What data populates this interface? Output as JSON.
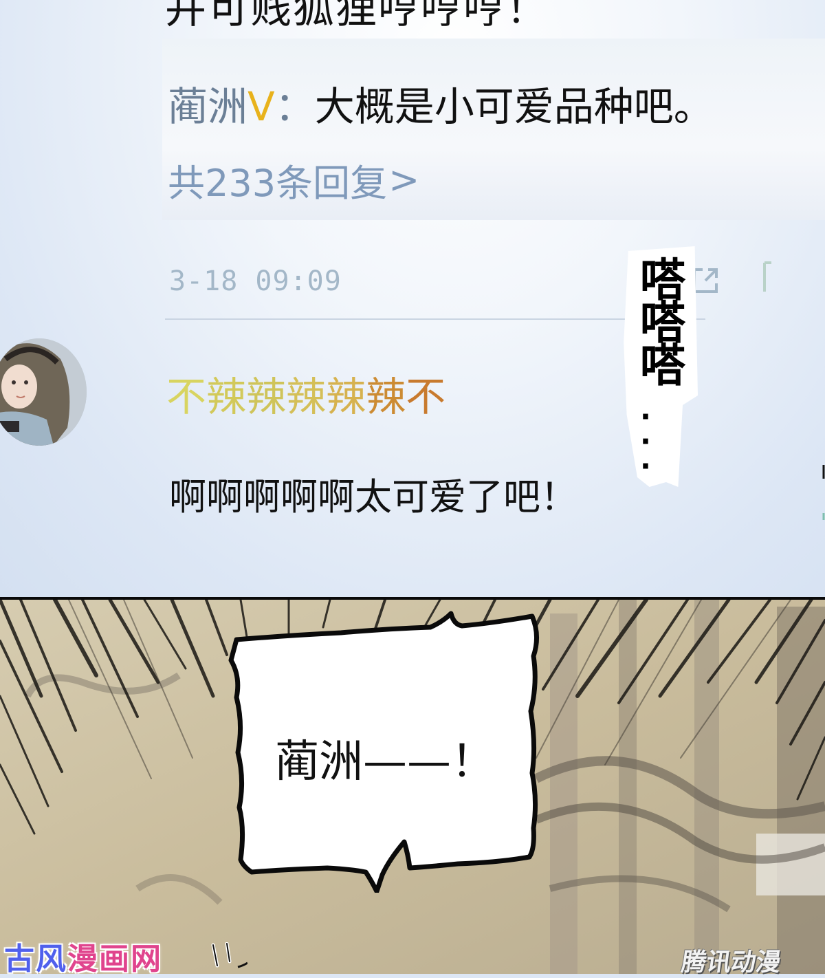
{
  "comment_screen": {
    "previous_comment_partial": "并可贱狐狸哼哼哼！",
    "reply": {
      "author": "蔺洲",
      "verified_badge": "V",
      "colon": "：",
      "text": "大概是小可爱品种吧。"
    },
    "more_replies_label": "共233条回复",
    "more_replies_chevron": ">",
    "timestamp": "3-18 09:09",
    "share_icon": "share-icon",
    "comment": {
      "username_chars": [
        "不",
        "辣",
        "辣",
        "辣",
        "辣",
        "辣",
        "不"
      ],
      "username_colors": [
        "#d8d460",
        "#d2c95a",
        "#cfc45a",
        "#d4bf58",
        "#d6b24f",
        "#cc8b33",
        "#c87a2e"
      ],
      "text": "啊啊啊啊啊太可爱了吧！"
    }
  },
  "sfx": {
    "text": "嗒嗒嗒",
    "dots": "···"
  },
  "panel": {
    "speech": "蔺洲——！"
  },
  "watermarks": {
    "left_part1": "古风",
    "left_part2": "漫画网",
    "right": "腾讯动漫"
  },
  "colors": {
    "screen_bg": "#dde7f5",
    "author_grey": "#6b7f96",
    "verified_gold": "#e8b21c",
    "link_blue": "#7f99ba",
    "timestamp_grey": "#a3b7c8"
  }
}
